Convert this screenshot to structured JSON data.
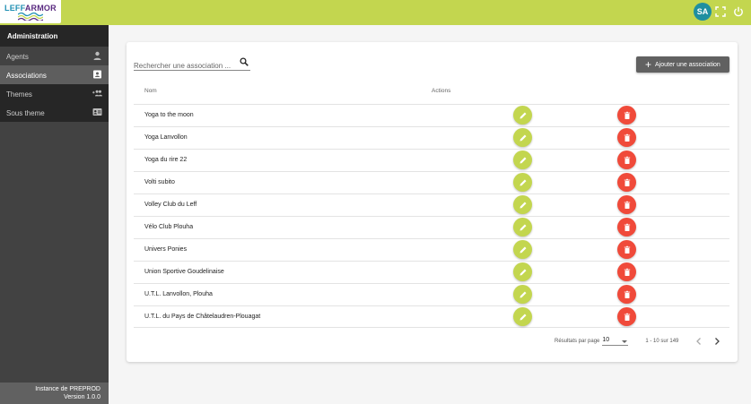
{
  "header": {
    "logo": {
      "part1": "LEFF",
      "part2": "ARMOR"
    },
    "avatar_initials": "SA",
    "icons": [
      "fullscreen-icon",
      "power-icon"
    ],
    "colors": {
      "topbar": "#c3d64f",
      "avatar": "#1f8fa0"
    }
  },
  "sidebar": {
    "title": "Administration",
    "items": [
      {
        "label": "Agents",
        "icon": "person-icon"
      },
      {
        "label": "Associations",
        "icon": "contact-icon"
      },
      {
        "label": "Themes",
        "icon": "group-add-icon"
      },
      {
        "label": "Sous theme",
        "icon": "badge-icon"
      }
    ],
    "footer": {
      "instance": "Instance de PREPROD",
      "version": "Version 1.0.0"
    }
  },
  "main": {
    "search": {
      "placeholder": "Rechercher une association ..."
    },
    "add_button": "Ajouter une association",
    "table": {
      "headers": {
        "name": "Nom",
        "actions": "Actions"
      },
      "rows": [
        "Yoga to the moon",
        "Yoga Lanvollon",
        "Yoga du rire 22",
        "Volti subito",
        "Volley Club du Leff",
        "Vélo Club Plouha",
        "Univers Ponies",
        "Union Sportive Goudelinaise",
        "U.T.L. Lanvollon, Plouha",
        "U.T.L. du Pays de Châtelaudren-Plouagat"
      ],
      "action_colors": {
        "edit": "#c3d64f",
        "delete": "#f04a3a"
      }
    },
    "pagination": {
      "per_page_label": "Résultats par page",
      "per_page_value": "10",
      "range": "1 - 10 sur 149"
    }
  }
}
